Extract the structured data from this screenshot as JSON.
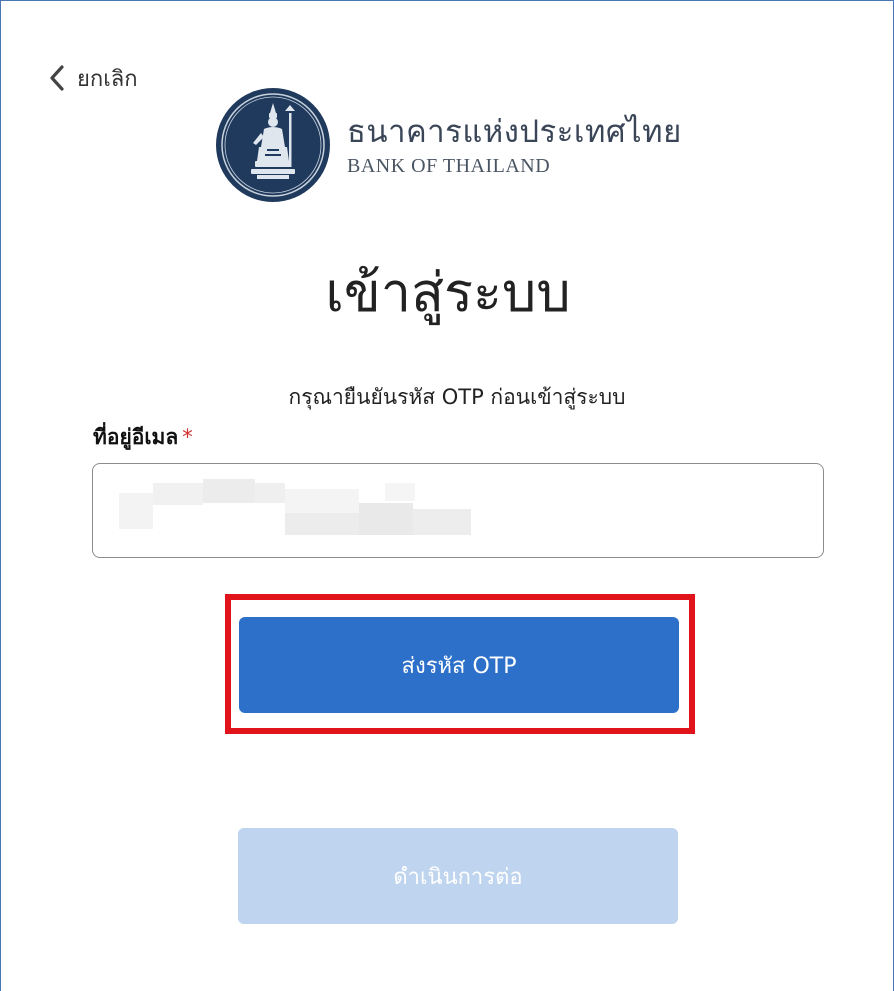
{
  "nav": {
    "cancel_label": "ยกเลิก"
  },
  "brand": {
    "name_th": "ธนาคารแห่งประเทศไทย",
    "name_en": "BANK OF THAILAND",
    "colors": {
      "seal_blue": "#1f3a5c",
      "text": "#3a4657"
    }
  },
  "page": {
    "title": "เข้าสู่ระบบ",
    "subtitle": "กรุณายืนยันรหัส OTP ก่อนเข้าสู่ระบบ"
  },
  "form": {
    "email_label": "ที่อยู่อีเมล",
    "required_mark": "*",
    "email_value": ""
  },
  "buttons": {
    "send_otp": "ส่งรหัส OTP",
    "continue": "ดำเนินการต่อ"
  },
  "colors": {
    "primary": "#2d70c9",
    "primary_disabled": "#bfd4ee",
    "highlight": "#e0141a",
    "required": "#d22f2f"
  }
}
